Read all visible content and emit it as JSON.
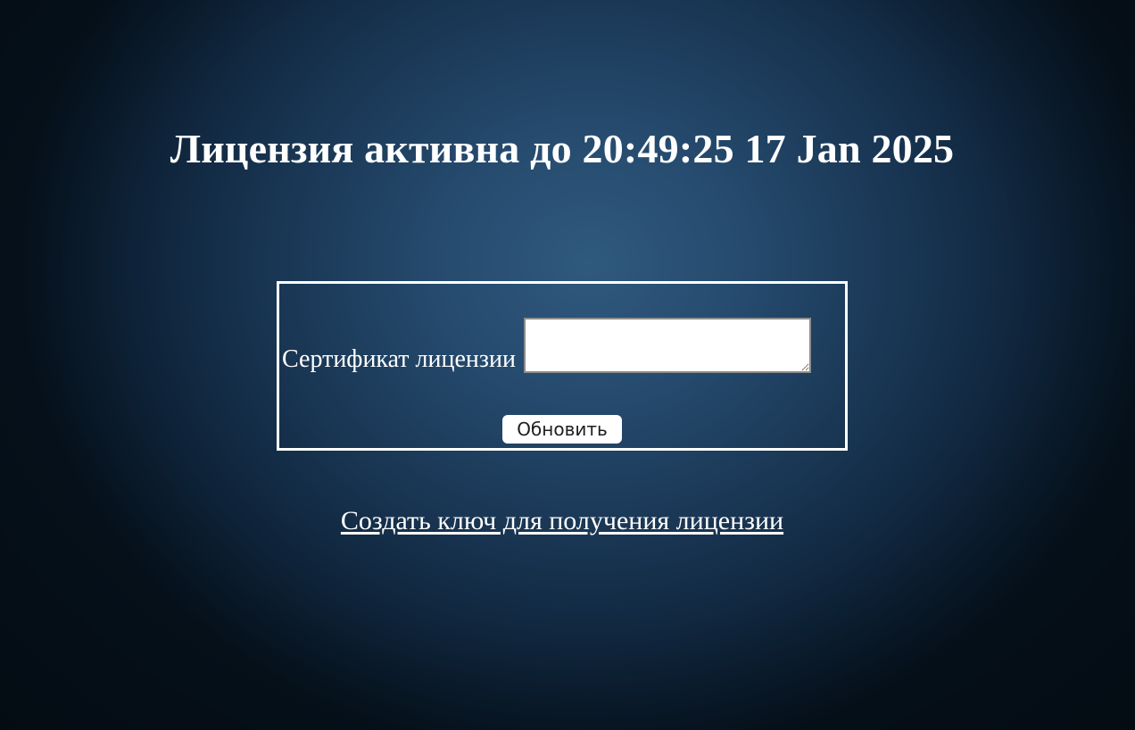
{
  "page": {
    "title": "Лицензия активна до 20:49:25 17 Jan 2025"
  },
  "license_form": {
    "certificate_label": "Сертификат лицензии",
    "certificate_value": "",
    "update_button_label": "Обновить"
  },
  "links": {
    "create_key_label": "Создать ключ для получения лицензии"
  },
  "colors": {
    "text": "#ffffff",
    "background_center": "#30597e",
    "background_edge": "#06121d",
    "box_border": "#ffffff",
    "button_background": "#ffffff",
    "button_text": "#1e1e1e"
  }
}
